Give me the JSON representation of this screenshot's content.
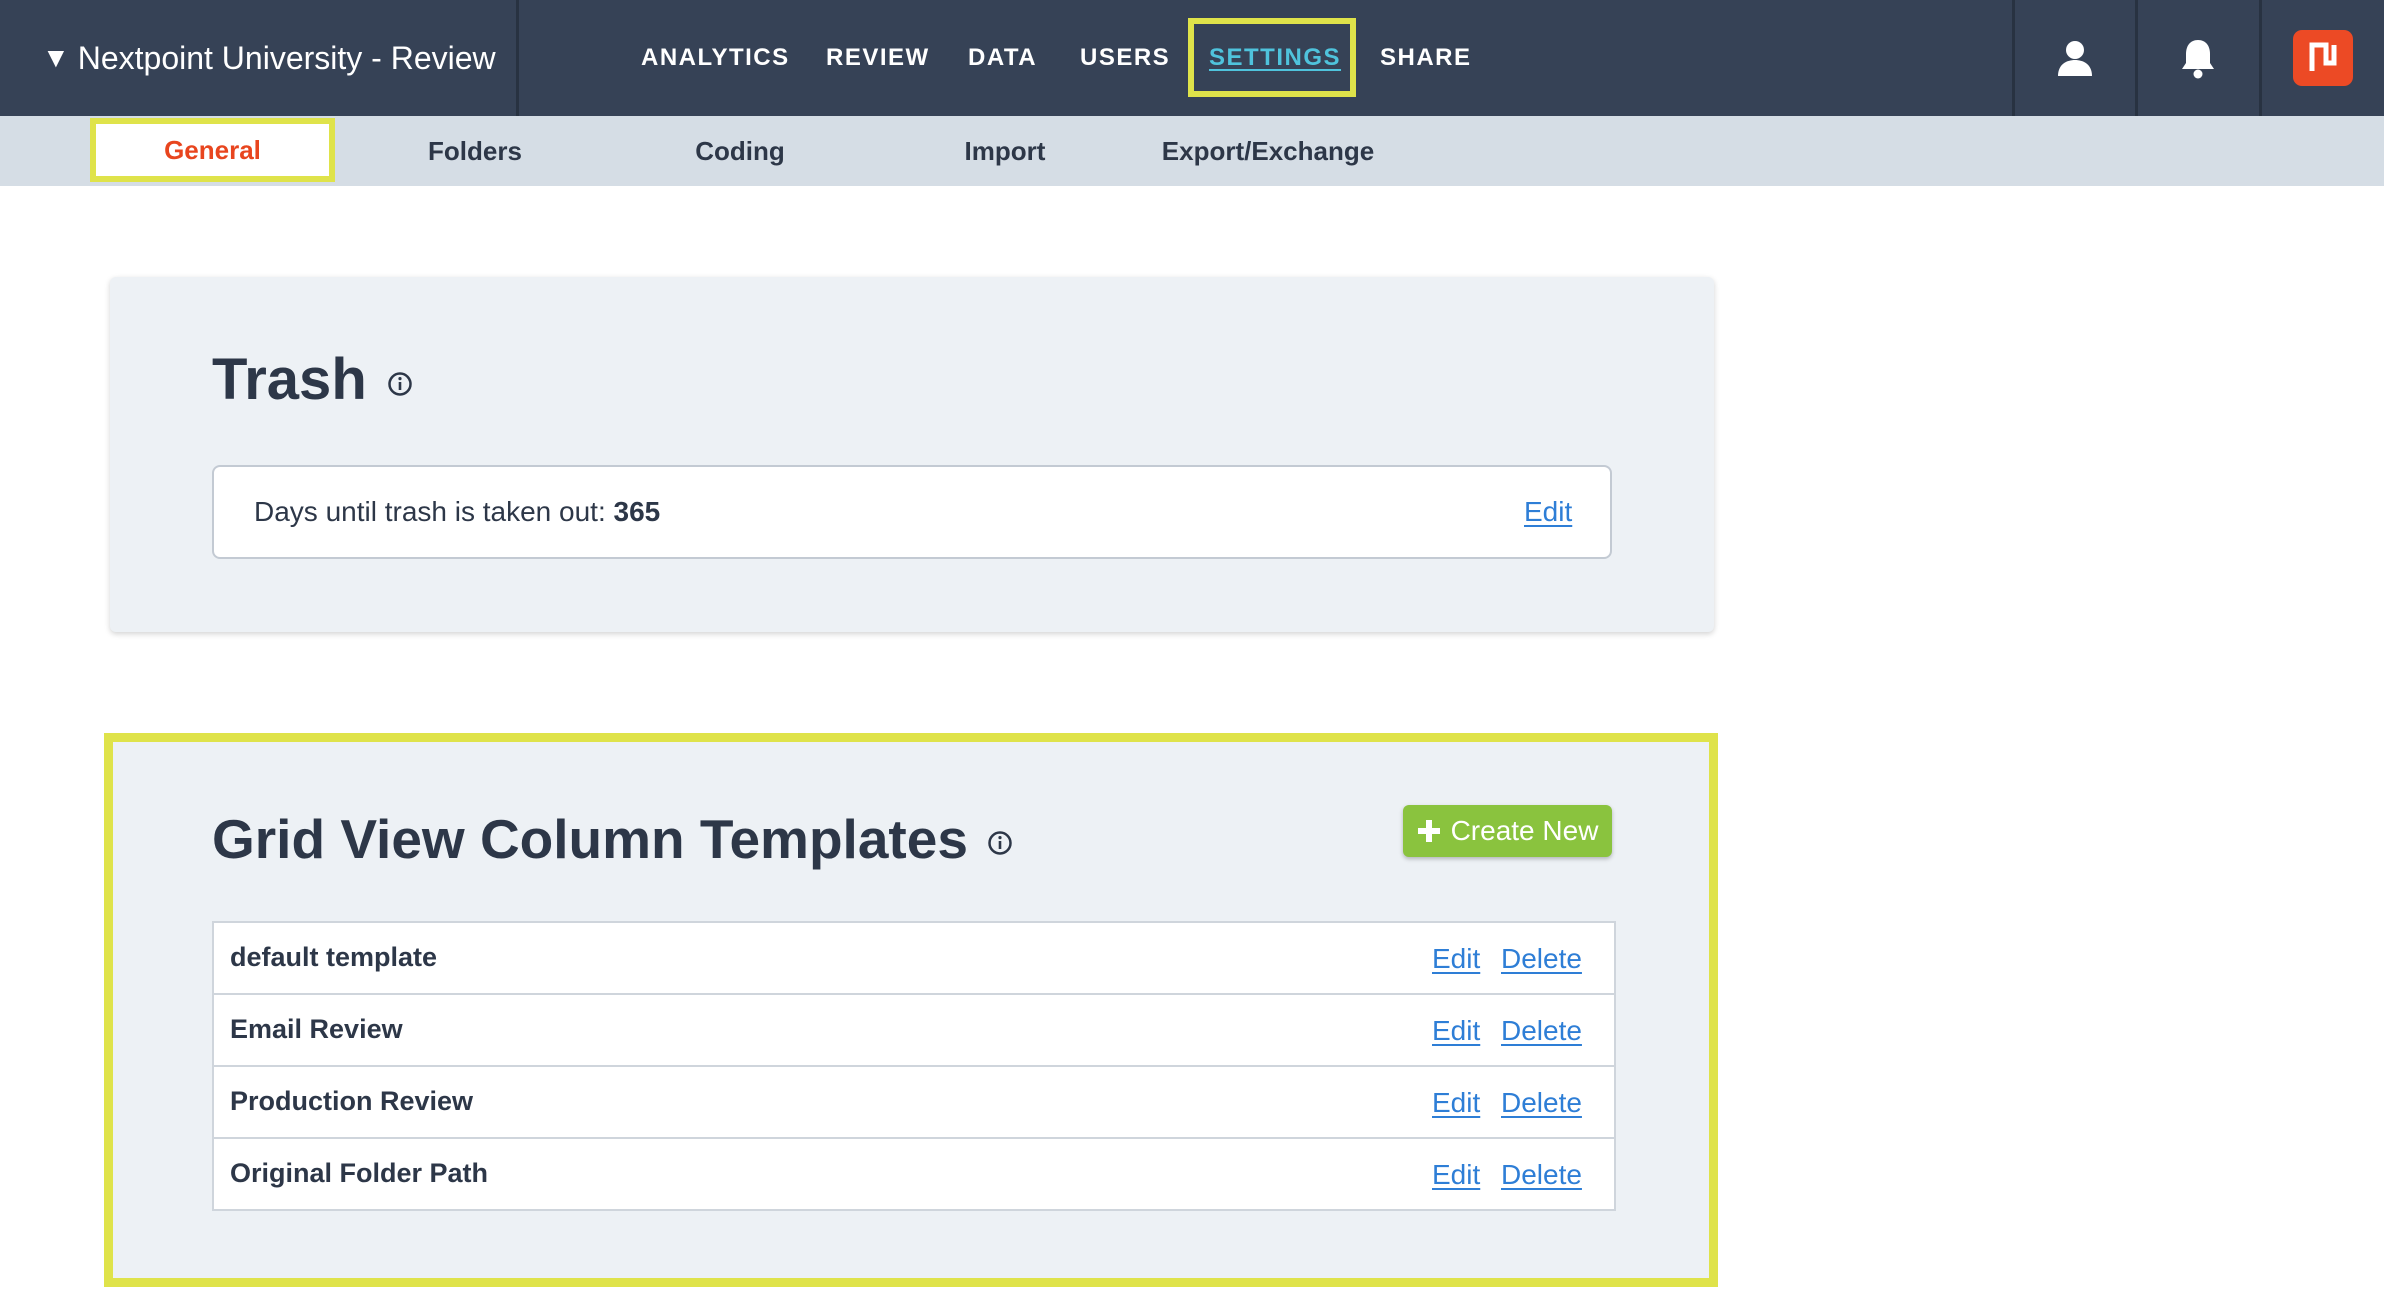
{
  "header": {
    "project_caret": "▼",
    "project_name": "Nextpoint University - Review",
    "nav": {
      "analytics": "ANALYTICS",
      "review": "REVIEW",
      "data": "DATA",
      "users": "USERS",
      "settings": "SETTINGS",
      "share": "SHARE"
    },
    "active_nav": "SETTINGS",
    "icons": [
      "user-icon",
      "bell-icon",
      "nextpoint-logo"
    ]
  },
  "subnav": {
    "general": "General",
    "folders": "Folders",
    "coding": "Coding",
    "import": "Import",
    "export_exchange": "Export/Exchange",
    "active": "General"
  },
  "trash": {
    "title": "Trash",
    "label": "Days until trash is taken out:",
    "days": "365",
    "edit_label": "Edit"
  },
  "grid_templates": {
    "title": "Grid View Column Templates",
    "create_label": "Create New",
    "rows": [
      {
        "name": "default template",
        "edit": "Edit",
        "delete": "Delete"
      },
      {
        "name": "Email Review",
        "edit": "Edit",
        "delete": "Delete"
      },
      {
        "name": "Production Review",
        "edit": "Edit",
        "delete": "Delete"
      },
      {
        "name": "Original Folder Path",
        "edit": "Edit",
        "delete": "Delete"
      }
    ]
  },
  "colors": {
    "topbar": "#364256",
    "subnav": "#d5dde5",
    "highlight": "#dfe34a",
    "active_tab_text": "#e8451e",
    "active_nav_text": "#4fc3dc",
    "link": "#2e7ed6",
    "create_button": "#8ac33e",
    "logo": "#ec4a25"
  }
}
